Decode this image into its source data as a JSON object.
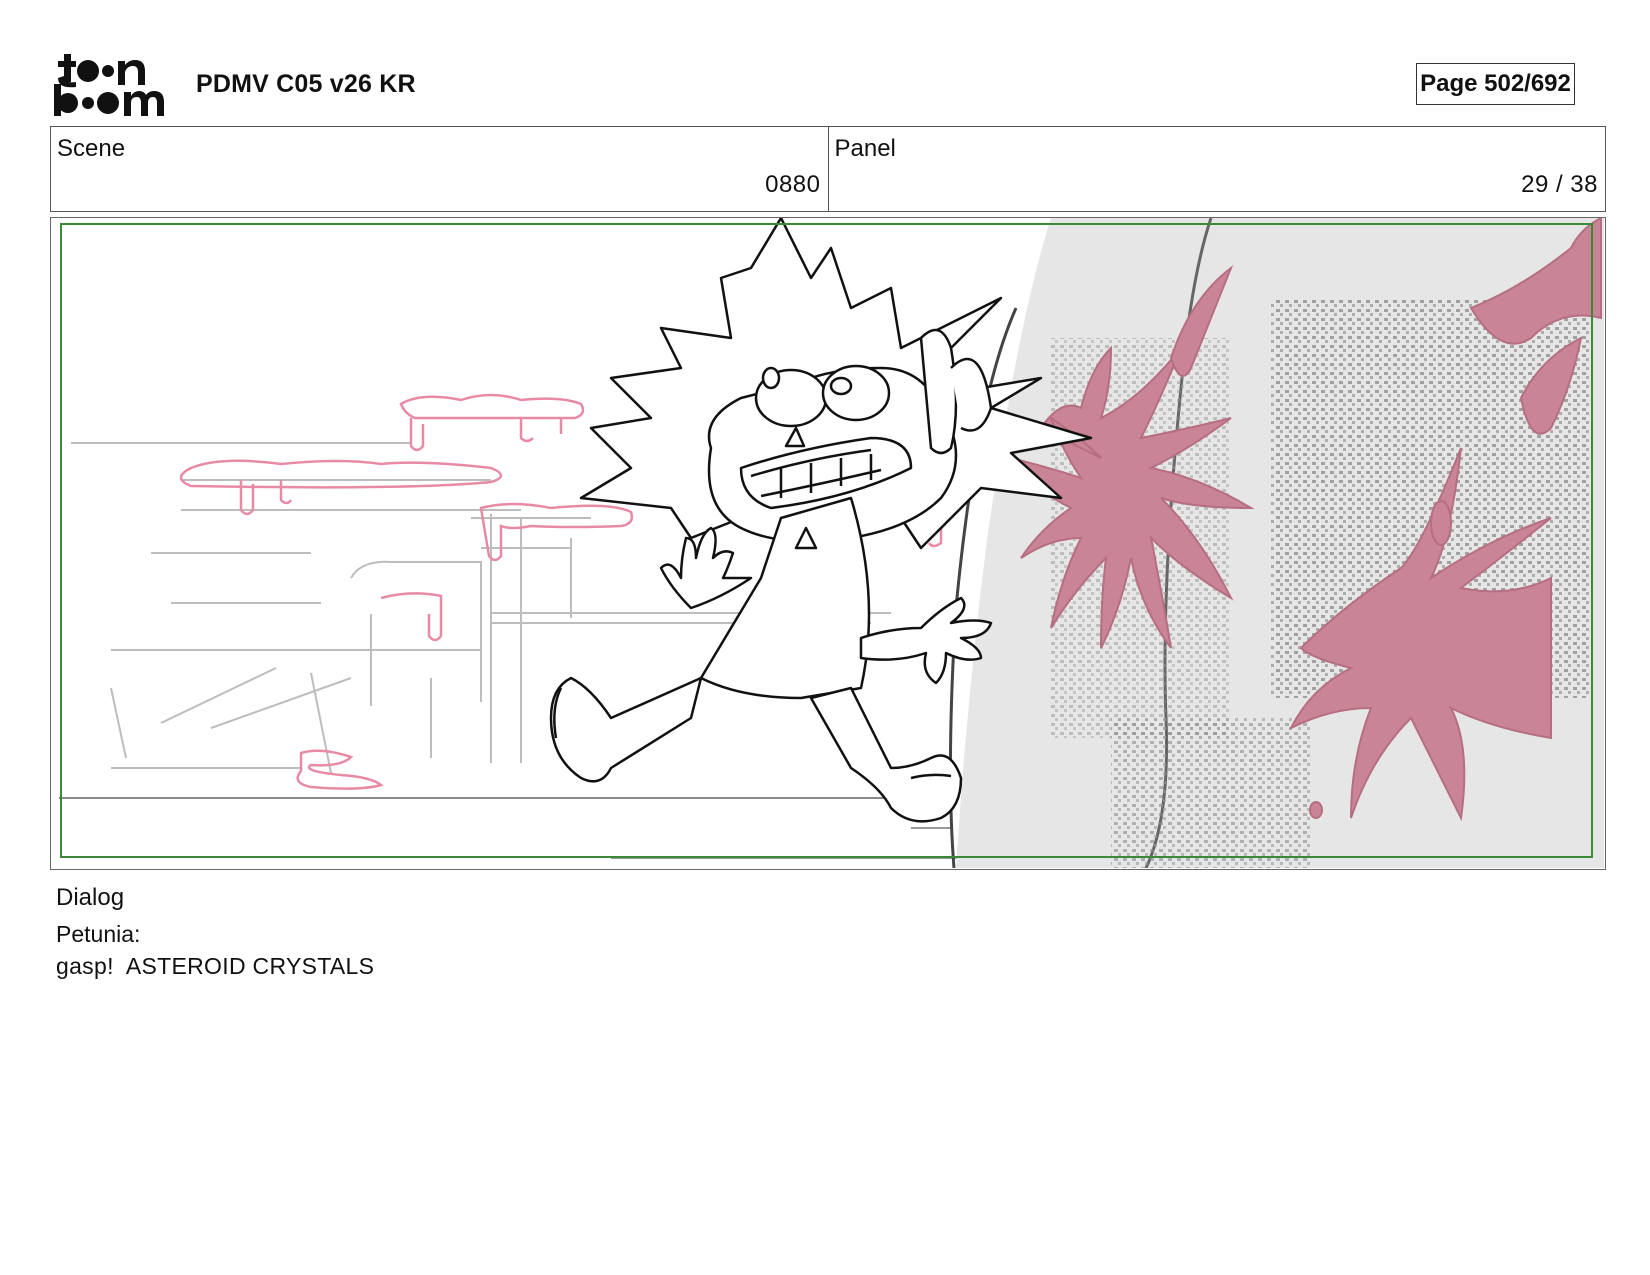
{
  "header": {
    "logo_text": "toon boom",
    "title": "PDMV C05 v26 KR",
    "page_label": "Page 502/692"
  },
  "info": {
    "scene_label": "Scene",
    "scene_value": "0880",
    "panel_label": "Panel",
    "panel_value": "29 / 38"
  },
  "panel": {
    "safe_frame_color": "#3a8a3a",
    "splat_color": "#c98496",
    "sketch_pink": "#e98aa4"
  },
  "dialog": {
    "label": "Dialog",
    "speaker": "Petunia:",
    "line": "gasp!  ASTEROID CRYSTALS"
  }
}
